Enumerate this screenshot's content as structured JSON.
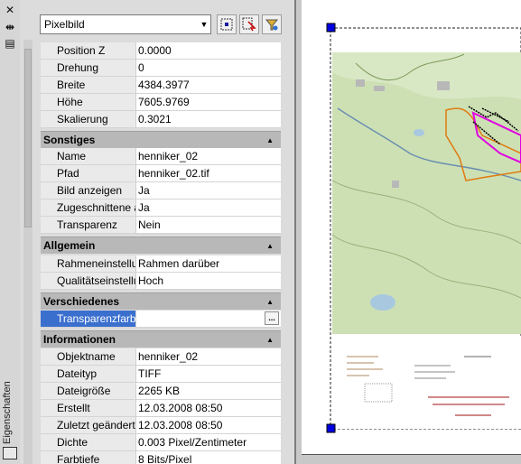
{
  "palette": {
    "side_label": "Eigenschaften",
    "close_glyph": "✕",
    "hide_glyph": "⇹",
    "props_glyph": "▤"
  },
  "header": {
    "object_type": "Pixelbild",
    "dropdown_glyph": "▼"
  },
  "rows_top": [
    {
      "key": "Position Z",
      "value": "0.0000"
    },
    {
      "key": "Drehung",
      "value": "0"
    },
    {
      "key": "Breite",
      "value": "4384.3977"
    },
    {
      "key": "Höhe",
      "value": "7605.9769"
    },
    {
      "key": "Skalierung",
      "value": "0.3021"
    }
  ],
  "sections": {
    "sonstiges": {
      "title": "Sonstiges",
      "rows": [
        {
          "key": "Name",
          "value": "henniker_02"
        },
        {
          "key": "Pfad",
          "value": "henniker_02.tif"
        },
        {
          "key": "Bild anzeigen",
          "value": "Ja"
        },
        {
          "key": "Zugeschnittene an...",
          "value": "Ja"
        },
        {
          "key": "Transparenz",
          "value": "Nein"
        }
      ]
    },
    "allgemein": {
      "title": "Allgemein",
      "rows": [
        {
          "key": "Rahmeneinstellung",
          "value": "Rahmen darüber"
        },
        {
          "key": "Qualitätseinstellung",
          "value": "Hoch"
        }
      ]
    },
    "verschiedenes": {
      "title": "Verschiedenes",
      "rows": [
        {
          "key": "Transparenzfarbe",
          "value": ""
        }
      ],
      "ellipsis": "..."
    },
    "informationen": {
      "title": "Informationen",
      "rows": [
        {
          "key": "Objektname",
          "value": "henniker_02"
        },
        {
          "key": "Dateityp",
          "value": "TIFF"
        },
        {
          "key": "Dateigröße",
          "value": "2265 KB"
        },
        {
          "key": "Erstellt",
          "value": "12.03.2008 08:50"
        },
        {
          "key": "Zuletzt geändert",
          "value": "12.03.2008 08:50"
        },
        {
          "key": "Dichte",
          "value": "0.003 Pixel/Zentimeter"
        },
        {
          "key": "Farbtiefe",
          "value": "8 Bits/Pixel"
        }
      ]
    }
  },
  "collapse_glyph": "▲",
  "colors": {
    "selection": "#3a6fce",
    "section_header": "#b8b8b8",
    "grip": "#0000e0",
    "map_green": "#c9dcb0",
    "boundary_orange": "#e07a10",
    "parcel_magenta": "#e000e0"
  }
}
